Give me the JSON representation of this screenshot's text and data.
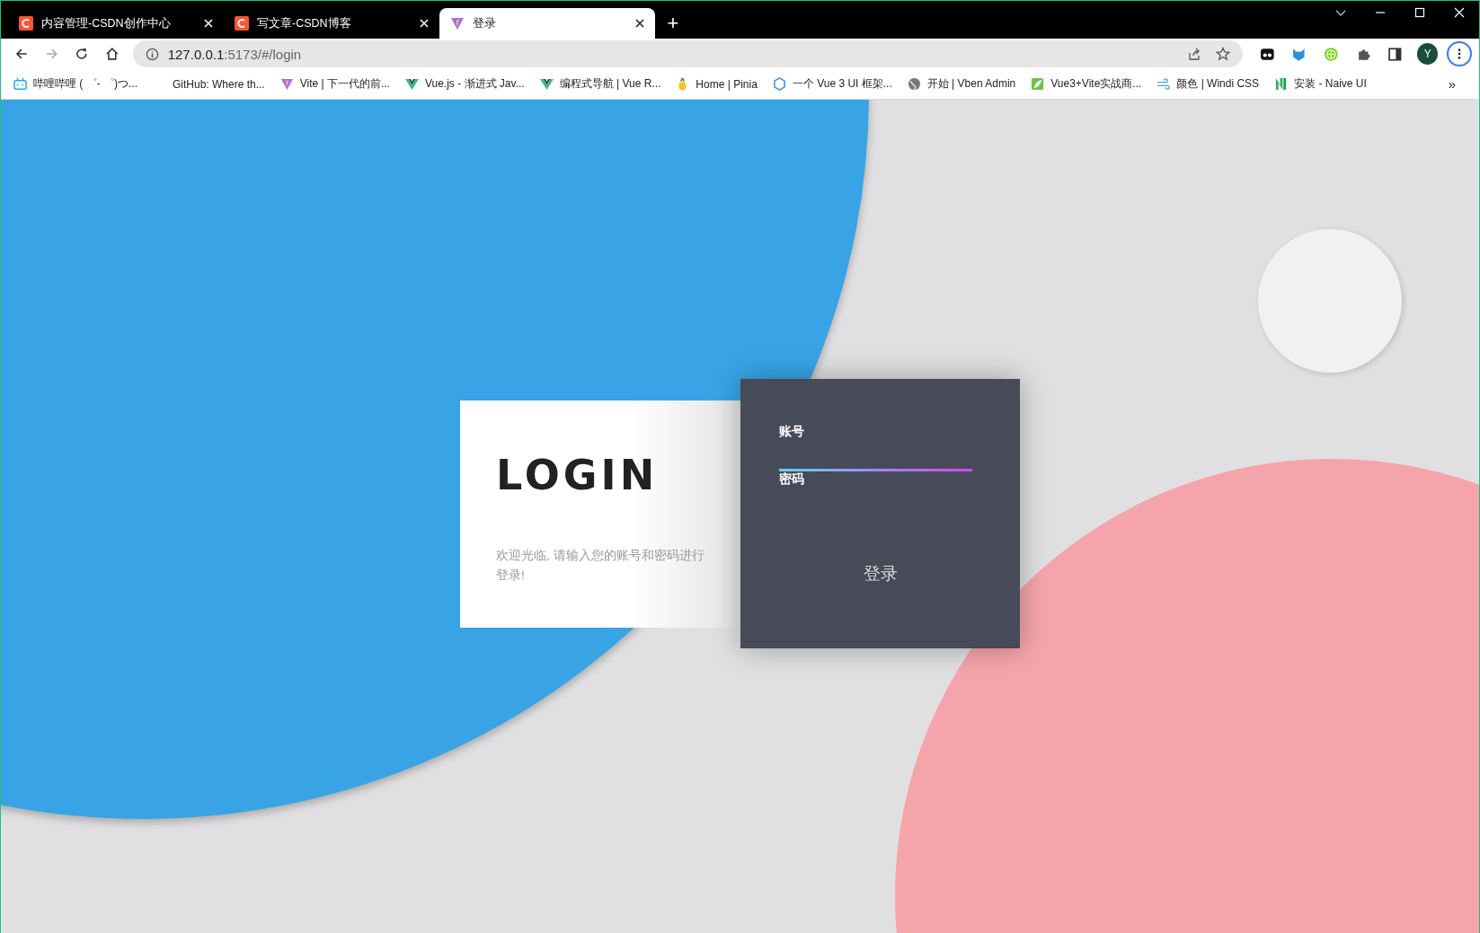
{
  "browser": {
    "tabs": [
      {
        "title": "内容管理-CSDN创作中心",
        "selected": false
      },
      {
        "title": "写文章-CSDN博客",
        "selected": false
      },
      {
        "title": "登录",
        "selected": true
      }
    ],
    "new_tab": "+",
    "address": {
      "host": "127.0.0.1",
      "path": ":5173/#/login"
    },
    "profile": "Y",
    "bookmarks": [
      {
        "label": "哔哩哔哩 ( ゜- ゜)つ..."
      },
      {
        "label": "GitHub: Where th..."
      },
      {
        "label": "Vite | 下一代的前..."
      },
      {
        "label": "Vue.js - 渐进式 Jav..."
      },
      {
        "label": "编程式导航 | Vue R..."
      },
      {
        "label": "Home | Pinia"
      },
      {
        "label": "一个 Vue 3 UI 框架..."
      },
      {
        "label": "开始 | Vben Admin"
      },
      {
        "label": "Vue3+Vite实战商..."
      },
      {
        "label": "颜色 | Windi CSS"
      },
      {
        "label": "安装 - Naive UI"
      }
    ],
    "more": "»"
  },
  "login": {
    "title": "LOGIN",
    "welcome": "欢迎光临, 请输入您的账号和密码进行登录!",
    "fields": [
      {
        "label": "账号",
        "focused": true
      },
      {
        "label": "密码",
        "focused": false
      }
    ],
    "submit": "登录"
  }
}
